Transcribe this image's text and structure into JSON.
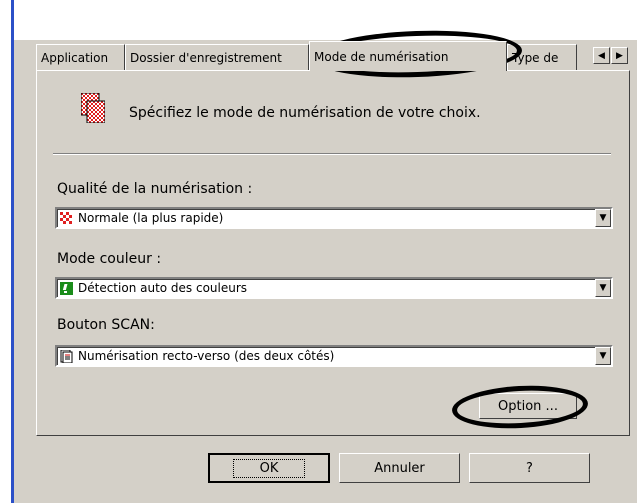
{
  "tabs": [
    {
      "label": "Application"
    },
    {
      "label": "Dossier d'enregistrement"
    },
    {
      "label": "Mode de numérisation"
    },
    {
      "label": "Type de"
    }
  ],
  "header": {
    "text": "Spécifiez le mode de numérisation de votre choix."
  },
  "quality": {
    "label": "Qualité de la numérisation :",
    "value": "Normale (la plus rapide)"
  },
  "color_mode": {
    "label": "Mode couleur :",
    "value": "Détection auto des couleurs"
  },
  "scan_button": {
    "label": "Bouton SCAN:",
    "value": "Numérisation recto-verso (des deux côtés)"
  },
  "buttons": {
    "option": "Option ...",
    "ok": "OK",
    "cancel": "Annuler",
    "help": "?"
  },
  "colors": {
    "accent": "#2b50c8",
    "checker_red": "#e02020"
  }
}
